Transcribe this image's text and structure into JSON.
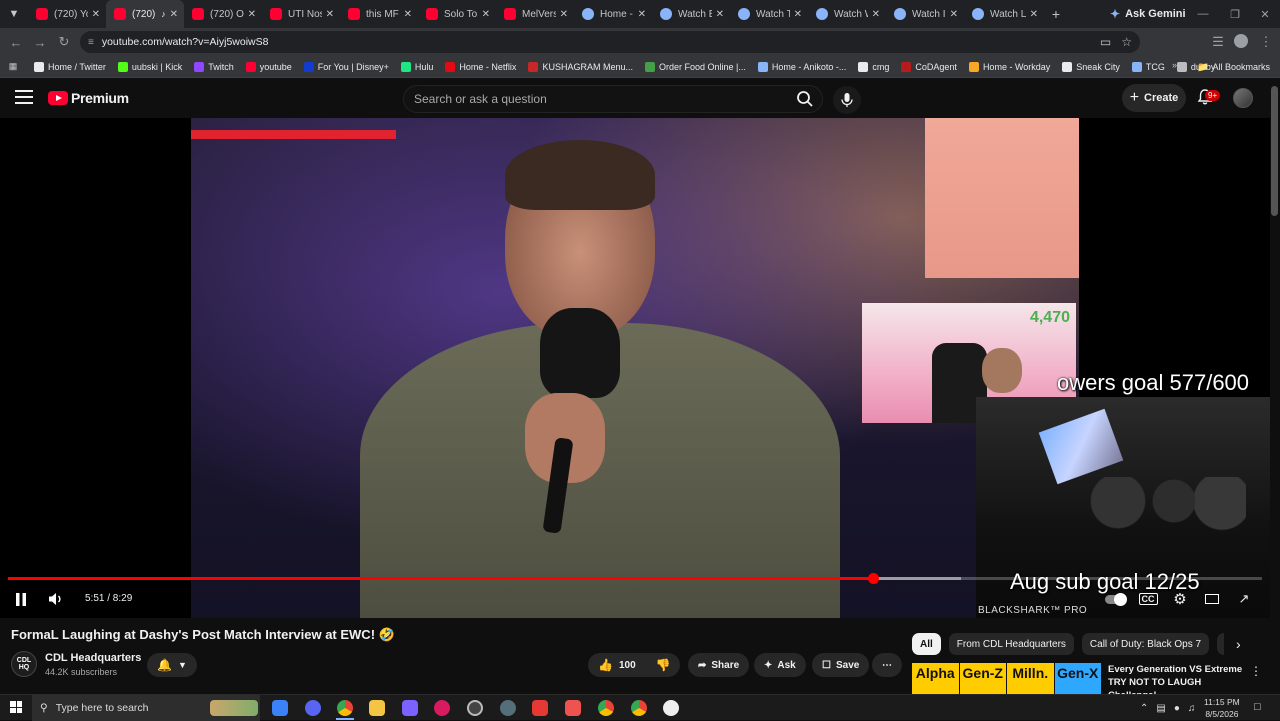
{
  "browser": {
    "tabs": [
      {
        "label": "(720) Yo",
        "icon": "youtube-icon",
        "active": false
      },
      {
        "label": "(720)",
        "icon": "youtube-icon",
        "active": true,
        "audio": true
      },
      {
        "label": "(720) Of",
        "icon": "youtube-icon",
        "active": false
      },
      {
        "label": "UTI Nos",
        "icon": "youtube-icon",
        "active": false
      },
      {
        "label": "this MF",
        "icon": "youtube-icon",
        "active": false
      },
      {
        "label": "Solo To",
        "icon": "youtube-icon",
        "active": false
      },
      {
        "label": "MelVers",
        "icon": "youtube-icon",
        "active": false
      },
      {
        "label": "Home -",
        "icon": "globe-icon",
        "active": false
      },
      {
        "label": "Watch B",
        "icon": "globe-icon",
        "active": false
      },
      {
        "label": "Watch T",
        "icon": "globe-icon",
        "active": false
      },
      {
        "label": "Watch W",
        "icon": "globe-icon",
        "active": false
      },
      {
        "label": "Watch I",
        "icon": "globe-icon",
        "active": false
      },
      {
        "label": "Watch L",
        "icon": "globe-icon",
        "active": false
      }
    ],
    "ask_gemini": "Ask Gemini",
    "url": "youtube.com/watch?v=Aiyj5woiwS8",
    "bookmarks": [
      {
        "label": "Home / Twitter",
        "color": "#e8eaed"
      },
      {
        "label": "uubski | Kick",
        "color": "#53fc18"
      },
      {
        "label": "Twitch",
        "color": "#9146ff"
      },
      {
        "label": "youtube",
        "color": "#ff0033"
      },
      {
        "label": "For You | Disney+",
        "color": "#113ccf"
      },
      {
        "label": "Hulu",
        "color": "#1ce783"
      },
      {
        "label": "Home - Netflix",
        "color": "#e50914"
      },
      {
        "label": "KUSHAGRAM Menu...",
        "color": "#c62828"
      },
      {
        "label": "Order Food Online |...",
        "color": "#43a047"
      },
      {
        "label": "Home - Anikoto -...",
        "color": "#8ab4f8"
      },
      {
        "label": "cmg",
        "color": "#e8eaed"
      },
      {
        "label": "CoDAgent",
        "color": "#b71c1c"
      },
      {
        "label": "Home - Workday",
        "color": "#f9a825"
      },
      {
        "label": "Sneak City",
        "color": "#e8eaed"
      },
      {
        "label": "TCG",
        "color": "#8ab4f8"
      },
      {
        "label": "dubby",
        "color": "#bdbdbd"
      }
    ],
    "all_bookmarks": "All Bookmarks"
  },
  "youtube": {
    "logo_text": "Premium",
    "search_placeholder": "Search or ask a question",
    "create_label": "Create",
    "notification_count": "9+"
  },
  "player": {
    "time_current": "5:51",
    "time_total": "8:29",
    "time_display": "5:51 / 8:29",
    "progress_played": 0.69,
    "progress_loaded": 0.76,
    "overlay": {
      "followers_count": "4,470",
      "followers_goal": "owers goal 577/600",
      "sub_goal": "Aug sub goal 12/25",
      "brand": "BLACKSHARK™ PRO"
    },
    "accent": "#ff0000"
  },
  "video": {
    "title": "FormaL Laughing at Dashy's Post Match Interview at EWC! 🤣",
    "channel_avatar_text": "CDL HQ",
    "channel_name": "CDL Headquarters",
    "subscribers": "44.2K subscribers",
    "likes": "100",
    "share_label": "Share",
    "ask_label": "Ask",
    "save_label": "Save"
  },
  "recommendations": {
    "chips": [
      "All",
      "From CDL Headquarters",
      "Call of Duty: Black Ops 7",
      "Come"
    ],
    "first": {
      "thumb_labels": [
        "Alpha",
        "Gen-Z",
        "Milln.",
        "Gen-X"
      ],
      "thumb_colors": [
        "#ffcc00",
        "#ffcc00",
        "#ffcc00",
        "#2ea8ff"
      ],
      "title": "Every Generation VS Extreme TRY NOT TO LAUGH Challenge!"
    }
  },
  "taskbar": {
    "search_placeholder": "Type here to search",
    "time": "11:15 PM",
    "date": "8/5/2026"
  }
}
